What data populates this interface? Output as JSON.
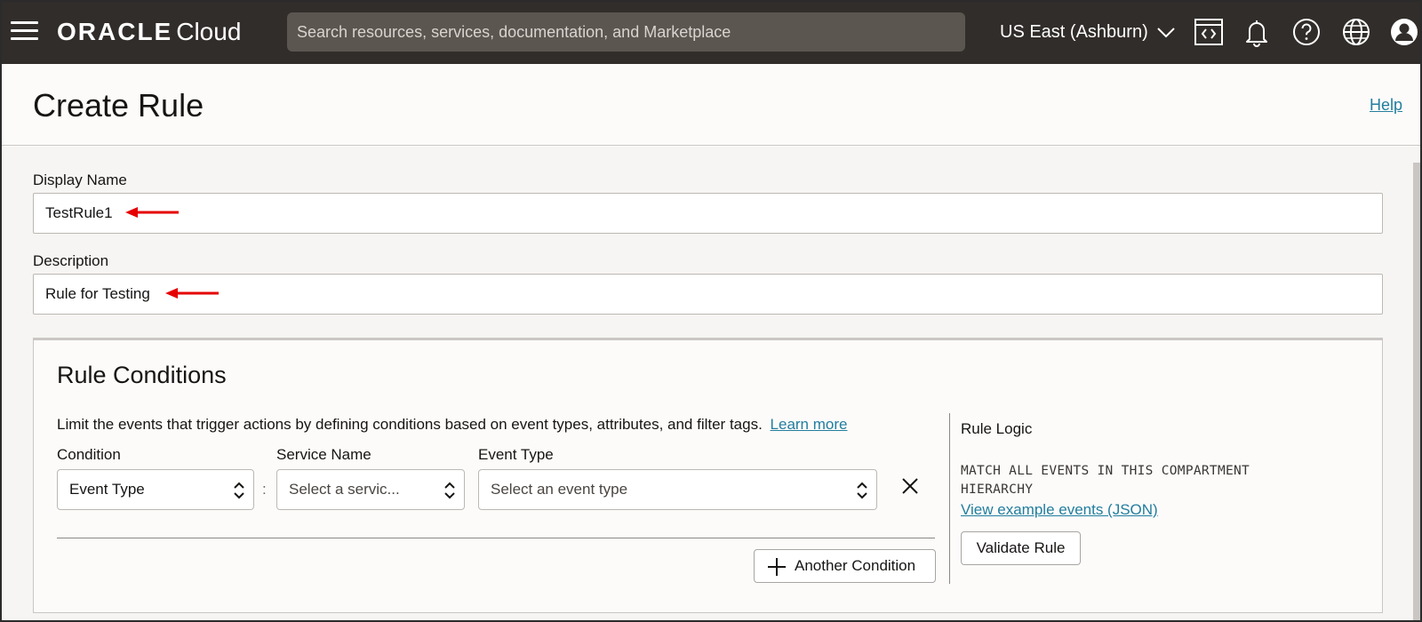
{
  "topbar": {
    "brand_primary": "ORACLE",
    "brand_secondary": "Cloud",
    "search_placeholder": "Search resources, services, documentation, and Marketplace",
    "region": "US East (Ashburn)",
    "icons": [
      "menu-icon",
      "code-editor-icon",
      "bell-icon",
      "help-icon",
      "globe-icon",
      "user-icon"
    ]
  },
  "header": {
    "title": "Create Rule",
    "help": "Help"
  },
  "form": {
    "display_name_label": "Display Name",
    "display_name_value": "TestRule1",
    "description_label": "Description",
    "description_value": "Rule for Testing"
  },
  "conditions": {
    "title": "Rule Conditions",
    "description": "Limit the events that trigger actions by defining conditions based on event types, attributes, and filter tags.",
    "learn_more": "Learn more",
    "condition_label": "Condition",
    "condition_value": "Event Type",
    "service_label": "Service Name",
    "service_value": "Select a servic...",
    "event_type_label": "Event Type",
    "event_type_value": "Select an event type",
    "another_condition": "Another Condition"
  },
  "rule_logic": {
    "label": "Rule Logic",
    "code_line1": "MATCH ALL EVENTS IN THIS COMPARTMENT",
    "code_line2": "HIERARCHY",
    "example_link": "View example events (JSON)",
    "validate": "Validate Rule"
  },
  "colors": {
    "topbar_bg": "#312d2a",
    "search_bg": "#5c5650",
    "link": "#227e9e",
    "annotation_arrow": "#e60000"
  }
}
